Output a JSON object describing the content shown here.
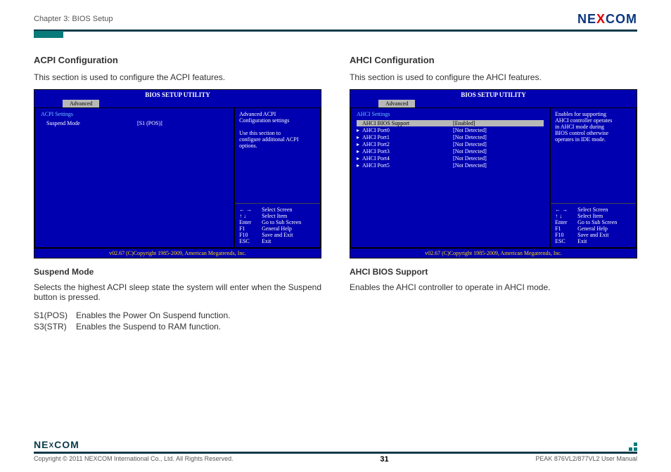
{
  "header": {
    "chapter": "Chapter 3: BIOS Setup",
    "logo_left": "NE",
    "logo_x": "X",
    "logo_right": "COM"
  },
  "left": {
    "title": "ACPI Configuration",
    "intro": "This section is used to configure the ACPI features.",
    "bios": {
      "title": "BIOS SETUP UTILITY",
      "tab": "Advanced",
      "section_header": "ACPI Settings",
      "rows": [
        {
          "label": "Suspend Mode",
          "value": "[S1 (POS)]",
          "selected": false
        }
      ],
      "help_top": [
        "Advanced ACPI",
        "Configuration settings",
        "",
        "Use this section to",
        "configure additional ACPI",
        "options."
      ],
      "keys": [
        {
          "k": "← →",
          "v": "Select Screen"
        },
        {
          "k": "↑ ↓",
          "v": "Select Item"
        },
        {
          "k": "Enter",
          "v": "Go to Sub Screen"
        },
        {
          "k": "F1",
          "v": "General Help"
        },
        {
          "k": "F10",
          "v": "Save and Exit"
        },
        {
          "k": "ESC",
          "v": "Exit"
        }
      ],
      "footer": "v02.67 (C)Copyright 1985-2009, American Megatrends, Inc."
    },
    "subhead": "Suspend Mode",
    "subdesc": "Selects the highest ACPI sleep state the system will enter when the Suspend button is pressed.",
    "options": [
      {
        "key": "S1(POS)",
        "desc": "Enables the Power On Suspend function."
      },
      {
        "key": "S3(STR)",
        "desc": "Enables the Suspend to RAM function."
      }
    ]
  },
  "right": {
    "title": "AHCI Configuration",
    "intro": "This section is used to configure the AHCI features.",
    "bios": {
      "title": "BIOS SETUP UTILITY",
      "tab": "Advanced",
      "section_header": "AHCI Settings",
      "rows": [
        {
          "arrow": "",
          "label": "AHCI BIOS Support",
          "value": "[Enabled]",
          "selected": true
        },
        {
          "arrow": "▸",
          "label": "AHCI Port0",
          "value": "[Not Detected]",
          "selected": false
        },
        {
          "arrow": "▸",
          "label": "AHCI Port1",
          "value": "[Not Detected]",
          "selected": false
        },
        {
          "arrow": "▸",
          "label": "AHCI Port2",
          "value": "[Not Detected]",
          "selected": false
        },
        {
          "arrow": "▸",
          "label": "AHCI Port3",
          "value": "[Not Detected]",
          "selected": false
        },
        {
          "arrow": "▸",
          "label": "AHCI Port4",
          "value": "[Not Detected]",
          "selected": false
        },
        {
          "arrow": "▸",
          "label": "AHCI Port5",
          "value": "[Not Detected]",
          "selected": false
        }
      ],
      "help_top": [
        "Enables for supporting",
        "AHCI controller operates",
        "in AHCI mode during",
        "BIOS control otherwise",
        "operates in IDE mode."
      ],
      "keys": [
        {
          "k": "← →",
          "v": "Select Screen"
        },
        {
          "k": "↑ ↓",
          "v": "Select Item"
        },
        {
          "k": "Enter",
          "v": "Go to Sub Screen"
        },
        {
          "k": "F1",
          "v": "General Help"
        },
        {
          "k": "F10",
          "v": "Save and Exit"
        },
        {
          "k": "ESC",
          "v": "Exit"
        }
      ],
      "footer": "v02.67 (C)Copyright 1985-2009, American Megatrends, Inc."
    },
    "subhead": "AHCI BIOS Support",
    "subdesc": "Enables the AHCI controller to operate in AHCI mode."
  },
  "footer": {
    "logo_left": "NE",
    "logo_x": "X",
    "logo_right": "COM",
    "copyright": "Copyright © 2011 NEXCOM International Co., Ltd. All Rights Reserved.",
    "page": "31",
    "manual": "PEAK 876VL2/877VL2 User Manual"
  }
}
